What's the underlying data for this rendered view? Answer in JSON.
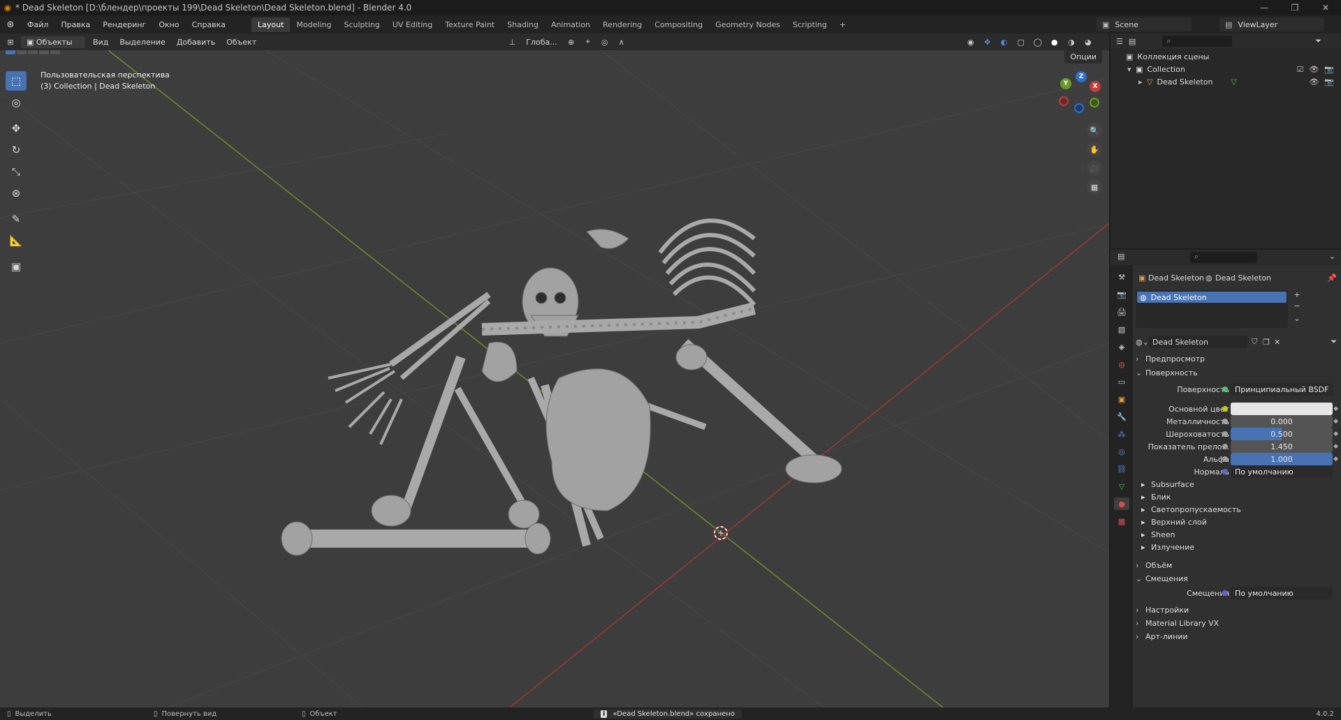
{
  "window": {
    "title": "* Dead Skeleton [D:\\блендер\\проекты 199\\Dead Skeleton\\Dead Skeleton.blend] - Blender 4.0",
    "controls": [
      "—",
      "❐",
      "✕"
    ]
  },
  "menu": [
    "Файл",
    "Правка",
    "Рендеринг",
    "Окно",
    "Справка"
  ],
  "workspaces": [
    "Layout",
    "Modeling",
    "Sculpting",
    "UV Editing",
    "Texture Paint",
    "Shading",
    "Animation",
    "Rendering",
    "Compositing",
    "Geometry Nodes",
    "Scripting",
    "+"
  ],
  "active_workspace": "Layout",
  "scene": {
    "name": "Scene",
    "view_layer": "ViewLayer"
  },
  "viewport_header": {
    "mode": "Объекты",
    "menus": [
      "Вид",
      "Выделение",
      "Добавить",
      "Объект"
    ],
    "transform_orientation": "Глоба...",
    "options_label": "Опции"
  },
  "viewport": {
    "perspective_label": "Пользовательская перспектива",
    "collection_label": "(3) Collection | Dead Skeleton",
    "gizmo_axes": [
      "X",
      "Y",
      "Z"
    ]
  },
  "outliner": {
    "root": "Коллекция сцены",
    "collection": "Collection",
    "object": "Dead Skeleton"
  },
  "properties": {
    "breadcrumb_object": "Dead Skeleton",
    "breadcrumb_material": "Dead Skeleton",
    "slot_name": "Dead Skeleton",
    "material_name": "Dead Skeleton",
    "panels": {
      "preview": "Предпросмотр",
      "surface": "Поверхность",
      "volume": "Объём",
      "displacement": "Смещения",
      "settings": "Настройки",
      "material_library": "Material Library VX",
      "lineart": "Арт-линии"
    },
    "surface_label": "Поверхность",
    "surface_value": "Принципиальный BSDF",
    "fields": {
      "base_color_label": "Основной цвет",
      "metallic_label": "Металличность",
      "metallic_value": "0.000",
      "roughness_label": "Шероховатость",
      "roughness_value": "0.500",
      "ior_label": "Показатель прело...",
      "ior_value": "1.450",
      "alpha_label": "Альфа",
      "alpha_value": "1.000",
      "normal_label": "Нормаль",
      "normal_value": "По умолчанию"
    },
    "subpanels": [
      "Subsurface",
      "Блик",
      "Светопропускаемость",
      "Верхний слой",
      "Sheen",
      "Излучение"
    ],
    "displacement_label": "Смещения",
    "displacement_value": "По умолчанию",
    "colors": {
      "accent": "#4772b3",
      "base_color": "#e6e6e6",
      "yellow_socket": "#c7c729",
      "purple_socket": "#6363c7"
    }
  },
  "statusbar": {
    "select": "Выделить",
    "rotate": "Повернуть вид",
    "object": "Объект",
    "message": "«Dead Skeleton.blend» сохранено",
    "version": "4.0.2"
  }
}
